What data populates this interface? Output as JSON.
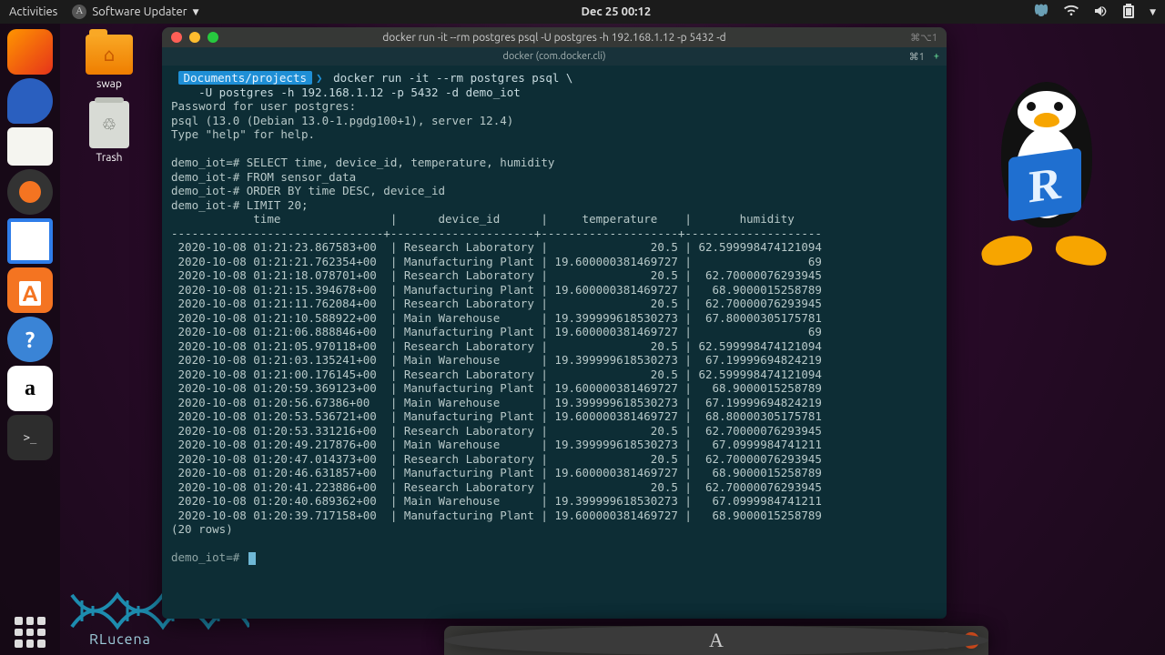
{
  "topbar": {
    "activities": "Activities",
    "app_indicator": "Software Updater",
    "clock": "Dec 25  00:12"
  },
  "desktop_icons": {
    "swap": "swap",
    "trash": "Trash"
  },
  "dock": {
    "items": [
      {
        "name": "firefox"
      },
      {
        "name": "thunderbird"
      },
      {
        "name": "files"
      },
      {
        "name": "rhythmbox"
      },
      {
        "name": "libreoffice-writer"
      },
      {
        "name": "ubuntu-software"
      },
      {
        "name": "help"
      },
      {
        "name": "amazon"
      },
      {
        "name": "terminal"
      },
      {
        "name": "software-updater"
      }
    ]
  },
  "terminal": {
    "window_title": "docker run -it --rm postgres psql -U postgres -h 192.168.1.12 -p 5432 -d",
    "tab_label": "docker (com.docker.cli)",
    "tab_shortcut": "⌘1",
    "titlebar_shortcut": "⌘⌥1",
    "prompt_path": "Documents/projects",
    "command_line1": "docker run -it --rm postgres psql \\",
    "command_line2": "    -U postgres -h 192.168.1.12 -p 5432 -d demo_iot",
    "passprompt": "Password for user postgres:",
    "psql_banner": "psql (13.0 (Debian 13.0-1.pgdg100+1), server 12.4)",
    "help_hint": "Type \"help\" for help.",
    "sql_lines": [
      "demo_iot=# SELECT time, device_id, temperature, humidity",
      "demo_iot-# FROM sensor_data",
      "demo_iot-# ORDER BY time DESC, device_id",
      "demo_iot-# LIMIT 20;"
    ],
    "columns": [
      "time",
      "device_id",
      "temperature",
      "humidity"
    ],
    "rows": [
      [
        "2020-10-08 01:21:23.867583+00",
        "Research Laboratory",
        "20.5",
        "62.59999847412109­4"
      ],
      [
        "2020-10-08 01:21:21.762354+00",
        "Manufacturing Plant",
        "19.600000381469727",
        "69"
      ],
      [
        "2020-10-08 01:21:18.078701+00",
        "Research Laboratory",
        "20.5",
        "62.70000076293945"
      ],
      [
        "2020-10-08 01:21:15.394678+00",
        "Manufacturing Plant",
        "19.600000381469727",
        "68.9000015258789"
      ],
      [
        "2020-10-08 01:21:11.762084+00",
        "Research Laboratory",
        "20.5",
        "62.70000076293945"
      ],
      [
        "2020-10-08 01:21:10.588922+00",
        "Main Warehouse",
        "19.399999618530273",
        "67.80000305175781"
      ],
      [
        "2020-10-08 01:21:06.888846+00",
        "Manufacturing Plant",
        "19.600000381469727",
        "69"
      ],
      [
        "2020-10-08 01:21:05.970118+00",
        "Research Laboratory",
        "20.5",
        "62.59999847412109­4"
      ],
      [
        "2020-10-08 01:21:03.135241+00",
        "Main Warehouse",
        "19.399999618530273",
        "67.1999969482421­9"
      ],
      [
        "2020-10-08 01:21:00.176145+00",
        "Research Laboratory",
        "20.5",
        "62.59999847412109­4"
      ],
      [
        "2020-10-08 01:20:59.369123+00",
        "Manufacturing Plant",
        "19.600000381469727",
        "68.9000015258789"
      ],
      [
        "2020-10-08 01:20:56.67386+00",
        "Main Warehouse",
        "19.399999618530273",
        "67.1999969482421­9"
      ],
      [
        "2020-10-08 01:20:53.536721+00",
        "Manufacturing Plant",
        "19.600000381469727",
        "68.80000305175781"
      ],
      [
        "2020-10-08 01:20:53.331216+00",
        "Research Laboratory",
        "20.5",
        "62.70000076293945"
      ],
      [
        "2020-10-08 01:20:49.217876+00",
        "Main Warehouse",
        "19.399999618530273",
        "67.0999984741211"
      ],
      [
        "2020-10-08 01:20:47.014373+00",
        "Research Laboratory",
        "20.5",
        "62.70000076293945"
      ],
      [
        "2020-10-08 01:20:46.631857+00",
        "Manufacturing Plant",
        "19.600000381469727",
        "68.9000015258789"
      ],
      [
        "2020-10-08 01:20:41.223886+00",
        "Research Laboratory",
        "20.5",
        "62.70000076293945"
      ],
      [
        "2020-10-08 01:20:40.689362+00",
        "Main Warehouse",
        "19.399999618530273",
        "67.0999984741211"
      ],
      [
        "2020-10-08 01:20:39.717158+00",
        "Manufacturing Plant",
        "19.600000381469727",
        "68.9000015258789"
      ]
    ],
    "row_count_label": "(20 rows)",
    "next_prompt": "demo_iot=#"
  },
  "updater": {
    "title": "Software Updater"
  },
  "watermark": {
    "label": "RLucena"
  }
}
